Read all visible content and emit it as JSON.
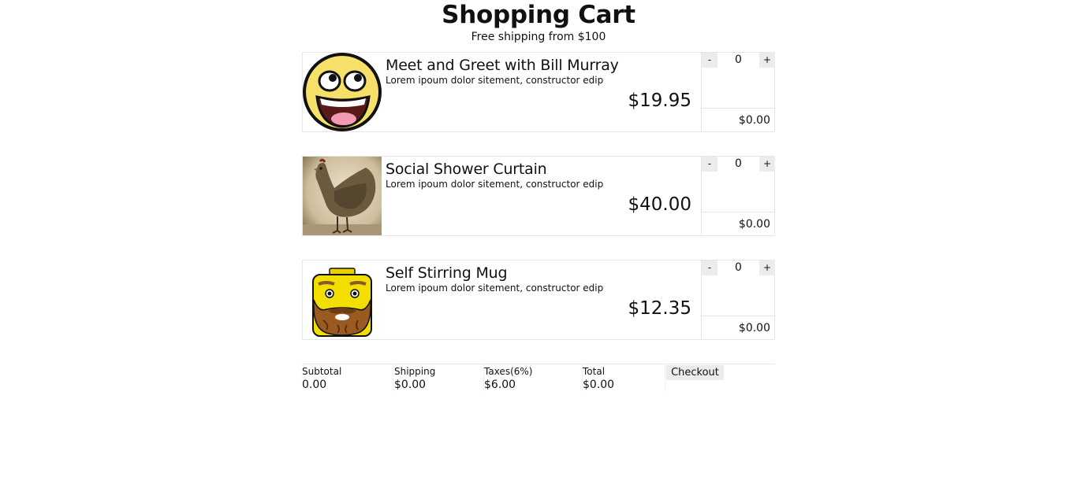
{
  "header": {
    "title": "Shopping Cart",
    "subtitle": "Free shipping from $100"
  },
  "items": [
    {
      "name": "Meet and Greet with Bill Murray",
      "description": "Lorem ipoum dolor sitement, constructor edip",
      "price": "$19.95",
      "quantity": "0",
      "line_total": "$0.00",
      "decrement_label": "-",
      "increment_label": "+",
      "image": "smiley-face-icon"
    },
    {
      "name": "Social Shower Curtain",
      "description": "Lorem ipoum dolor sitement, constructor edip",
      "price": "$40.00",
      "quantity": "0",
      "line_total": "$0.00",
      "decrement_label": "-",
      "increment_label": "+",
      "image": "chicken-photo"
    },
    {
      "name": "Self Stirring Mug",
      "description": "Lorem ipoum dolor sitement, constructor edip",
      "price": "$12.35",
      "quantity": "0",
      "line_total": "$0.00",
      "decrement_label": "-",
      "increment_label": "+",
      "image": "lego-head-icon"
    }
  ],
  "summary": {
    "subtotal_label": "Subtotal",
    "subtotal_value": "0.00",
    "shipping_label": "Shipping",
    "shipping_value": "$0.00",
    "taxes_label": "Taxes(6%)",
    "taxes_value": "$6.00",
    "total_label": "Total",
    "total_value": "$0.00",
    "checkout_label": "Checkout"
  }
}
